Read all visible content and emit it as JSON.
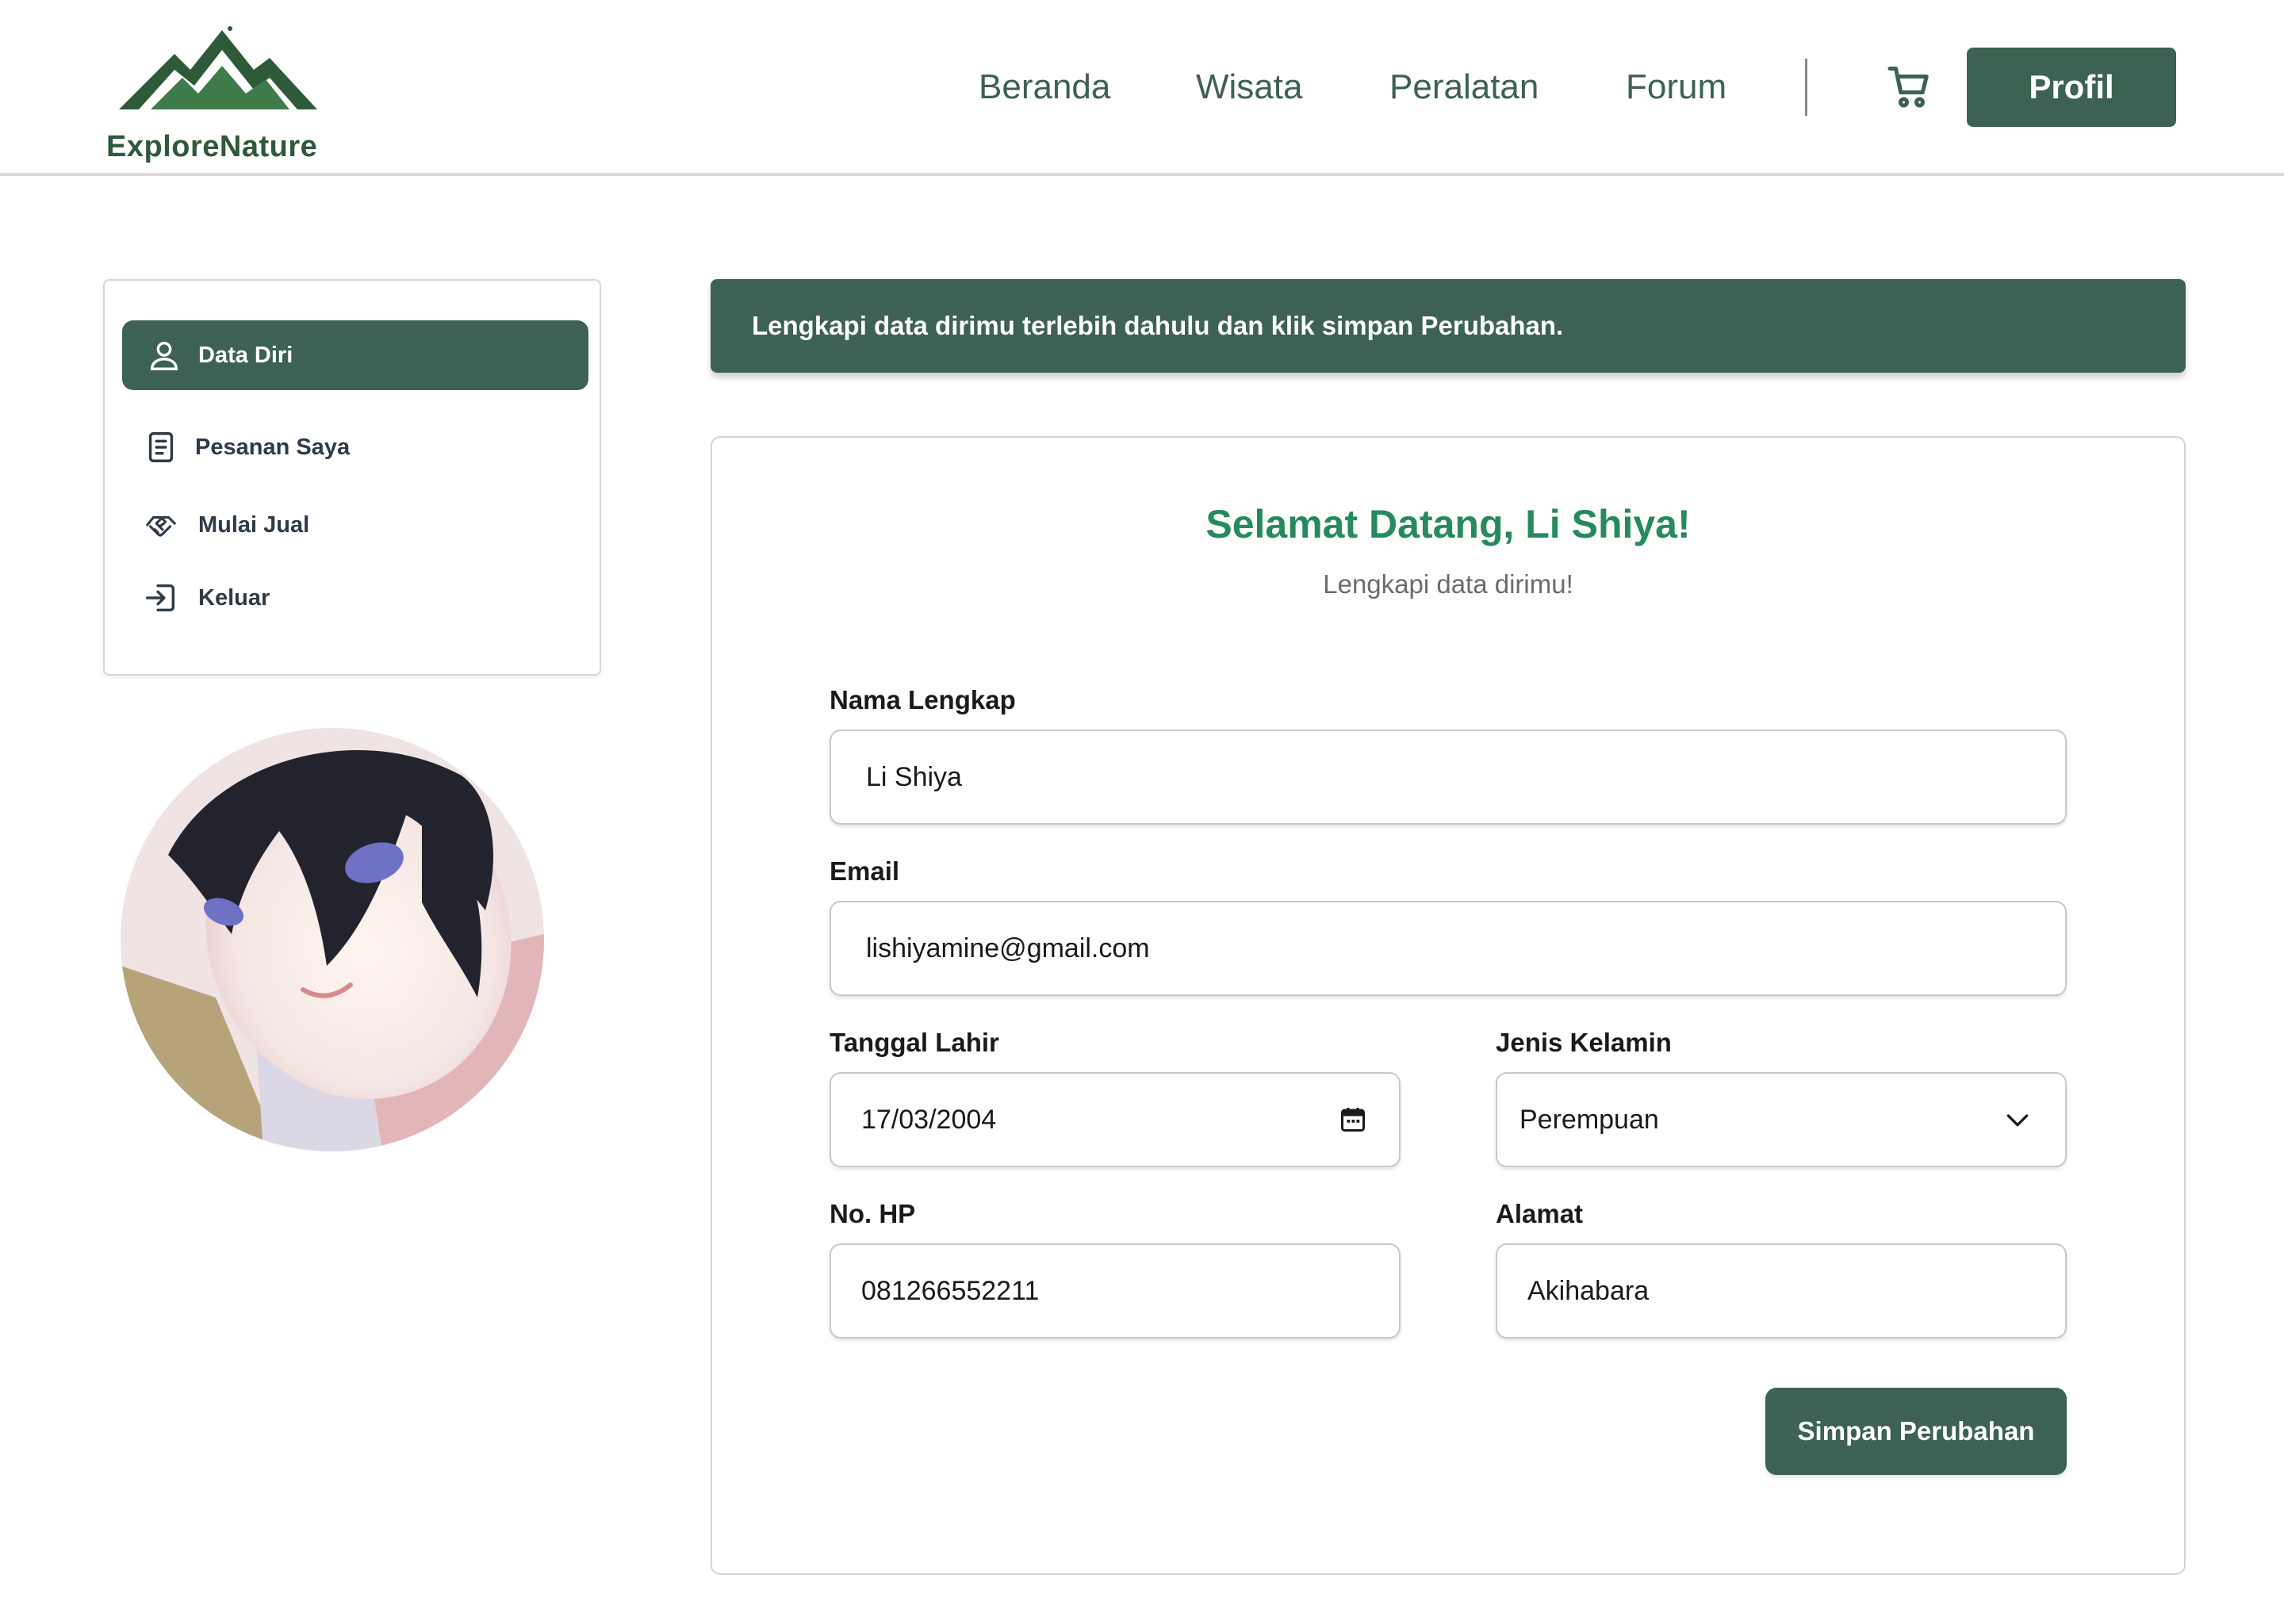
{
  "brand": {
    "name": "ExploreNature",
    "color": "#2f5a3a",
    "icon": "mountain-logo-icon"
  },
  "nav": {
    "items": [
      {
        "label": "Beranda"
      },
      {
        "label": "Wisata"
      },
      {
        "label": "Peralatan"
      },
      {
        "label": "Forum"
      }
    ],
    "cart_icon": "cart-icon",
    "profile_label": "Profil"
  },
  "sidebar": {
    "items": [
      {
        "label": "Data Diri",
        "icon": "user-icon",
        "active": true
      },
      {
        "label": "Pesanan Saya",
        "icon": "document-icon",
        "active": false
      },
      {
        "label": "Mulai Jual",
        "icon": "handshake-icon",
        "active": false
      },
      {
        "label": "Keluar",
        "icon": "logout-icon",
        "active": false
      }
    ],
    "avatar_icon": "profile-avatar"
  },
  "banner": {
    "text": "Lengkapi data dirimu terlebih dahulu dan klik simpan Perubahan."
  },
  "form": {
    "title": "Selamat Datang, Li Shiya!",
    "subtitle": "Lengkapi data dirimu!",
    "fields": {
      "nama": {
        "label": "Nama Lengkap",
        "value": "Li Shiya"
      },
      "email": {
        "label": "Email",
        "value": "lishiyamine@gmail.com"
      },
      "tanggal": {
        "label": "Tanggal Lahir",
        "value": "17/03/2004",
        "icon": "calendar-icon"
      },
      "kelamin": {
        "label": "Jenis Kelamin",
        "value": "Perempuan",
        "icon": "chevron-down-icon"
      },
      "hp": {
        "label": "No. HP",
        "value": "081266552211"
      },
      "alamat": {
        "label": "Alamat",
        "value": "Akihabara"
      }
    },
    "save_label": "Simpan Perubahan"
  },
  "colors": {
    "primary": "#3d6152",
    "title_green": "#268a5e",
    "border": "#c8c8c8"
  }
}
